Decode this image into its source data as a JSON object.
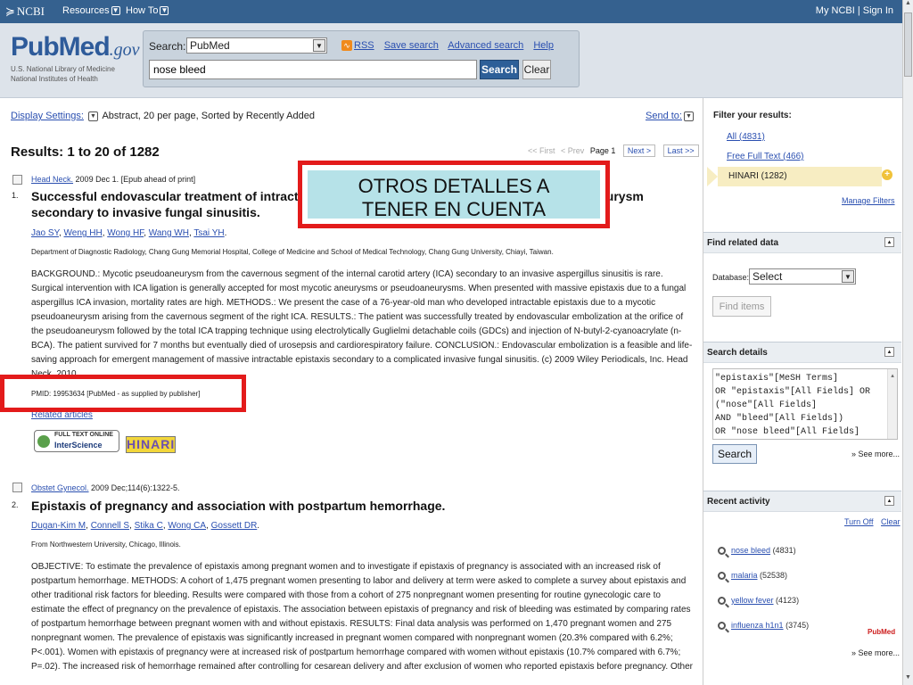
{
  "topbar": {
    "brand": "NCBI",
    "resources": "Resources",
    "howto": "How To",
    "account": "My NCBI | Sign In"
  },
  "header": {
    "logo_pub": "Pub",
    "logo_med": "Med",
    "logo_gov": ".gov",
    "org_line1": "U.S. National Library of Medicine",
    "org_line2": "National Institutes of Health",
    "search_label": "Search:",
    "database": "PubMed",
    "rss": "RSS",
    "save_search": "Save search",
    "advanced_search": "Advanced search",
    "help": "Help",
    "query": "nose bleed",
    "search_btn": "Search",
    "clear_btn": "Clear"
  },
  "main": {
    "display_settings": "Display Settings:",
    "display_value": "Abstract, 20 per page, Sorted by Recently Added",
    "send_to": "Send to:",
    "results_count": "Results: 1 to 20 of 1282",
    "pager": {
      "first": "<< First",
      "prev": "< Prev",
      "page": "Page 1",
      "next": "Next >",
      "last": "Last >>"
    },
    "results": [
      {
        "num": "1.",
        "source_journal": "Head Neck.",
        "source_rest": "2009 Dec 1. [Epub ahead of print]",
        "title_a": "Successful endovascular treatment of intractable",
        "title_b": "eurysm",
        "title_line2": "secondary to invasive fungal sinusitis.",
        "authors": [
          "Jao SY",
          "Weng HH",
          "Wong HF",
          "Wang WH",
          "Tsai YH"
        ],
        "affiliation": "Department of Diagnostic Radiology, Chang Gung Memorial Hospital, College of Medicine and School of Medical Technology, Chang Gung University, Chiayi, Taiwan.",
        "abstract": "BACKGROUND.: Mycotic pseudoaneurysm from the cavernous segment of the internal carotid artery (ICA) secondary to an invasive aspergillus sinusitis is rare. Surgical intervention with ICA ligation is generally accepted for most mycotic aneurysms or pseudoaneurysms. When presented with massive epistaxis due to a fungal aspergillus ICA invasion, mortality rates are high. METHODS.: We present the case of a 76-year-old man who developed intractable epistaxis due to a mycotic pseudoaneurysm arising from the cavernous segment of the right ICA. RESULTS.: The patient was successfully treated by endovascular embolization at the orifice of the pseudoaneurysm followed by the total ICA trapping technique using electrolytically Guglielmi detachable coils (GDCs) and injection of N-butyl-2-cyanoacrylate (n-BCA). The patient survived for 7 months but eventually died of urosepsis and cardiorespiratory failure. CONCLUSION.: Endovascular embolization is a feasible and life-saving approach for emergent management of massive intractable epistaxis secondary to a complicated invasive fungal sinusitis. (c) 2009 Wiley Periodicals, Inc. Head Neck, 2010.",
        "pmid": "PMID: 19953634 [PubMed - as supplied by publisher]",
        "related": "Related articles",
        "fulltext_top": "FULL TEXT ONLINE",
        "fulltext_brand": "InterScience",
        "hinari": "HINARI"
      },
      {
        "num": "2.",
        "source_journal": "Obstet Gynecol.",
        "source_rest": "2009 Dec;114(6):1322-5.",
        "title": "Epistaxis of pregnancy and association with postpartum hemorrhage.",
        "authors": [
          "Dugan-Kim M",
          "Connell S",
          "Stika C",
          "Wong CA",
          "Gossett DR"
        ],
        "affiliation": "From Northwestern University, Chicago, Illinois.",
        "abstract": "OBJECTIVE: To estimate the prevalence of epistaxis among pregnant women and to investigate if epistaxis of pregnancy is associated with an increased risk of postpartum hemorrhage. METHODS: A cohort of 1,475 pregnant women presenting to labor and delivery at term were asked to complete a survey about epistaxis and other traditional risk factors for bleeding. Results were compared with those from a cohort of 275 nonpregnant women presenting for routine gynecologic care to estimate the effect of pregnancy on the prevalence of epistaxis. The association between epistaxis of pregnancy and risk of bleeding was estimated by comparing rates of postpartum hemorrhage between pregnant women with and without epistaxis. RESULTS: Final data analysis was performed on 1,470 pregnant women and 275 nonpregnant women. The prevalence of epistaxis was significantly increased in pregnant women compared with nonpregnant women (20.3% compared with 6.2%; P<.001). Women with epistaxis of pregnancy were at increased risk of postpartum hemorrhage compared with women without epistaxis (10.7% compared with 6.7%; P=.02). The increased risk of hemorrhage remained after controlling for cesarean delivery and after exclusion of women who reported epistaxis before pregnancy. Other"
      }
    ]
  },
  "overlay": {
    "line1": "OTROS DETALLES A",
    "line2": "TENER EN CUENTA"
  },
  "sidebar": {
    "filter_title": "Filter your results:",
    "filters": [
      "All (4831)",
      "Free Full Text (466)"
    ],
    "active_filter": "HINARI (1282)",
    "manage_filters": "Manage Filters",
    "related_title": "Find related data",
    "db_label": "Database:",
    "db_value": "Select",
    "find_items": "Find items",
    "details_title": "Search details",
    "details_text": "\"epistaxis\"[MeSH Terms]\nOR \"epistaxis\"[All Fields] OR\n(\"nose\"[All Fields]\nAND \"bleed\"[All Fields])\nOR \"nose bleed\"[All Fields]",
    "details_search": "Search",
    "see_more": "» See more...",
    "recent_title": "Recent activity",
    "turn_off": "Turn Off",
    "clear": "Clear",
    "recent": [
      {
        "term": "nose bleed",
        "count": "(4831)"
      },
      {
        "term": "malaria",
        "count": "(52538)"
      },
      {
        "term": "yellow fever",
        "count": "(4123)"
      },
      {
        "term": "influenza h1n1",
        "count": "(3745)"
      }
    ],
    "pubmed_tag": "PubMed"
  },
  "colors": {
    "topbar": "#35618f",
    "highlight_red": "#e31b1b",
    "overlay_fill": "#b6e2e8",
    "link": "#2a4fb0"
  }
}
